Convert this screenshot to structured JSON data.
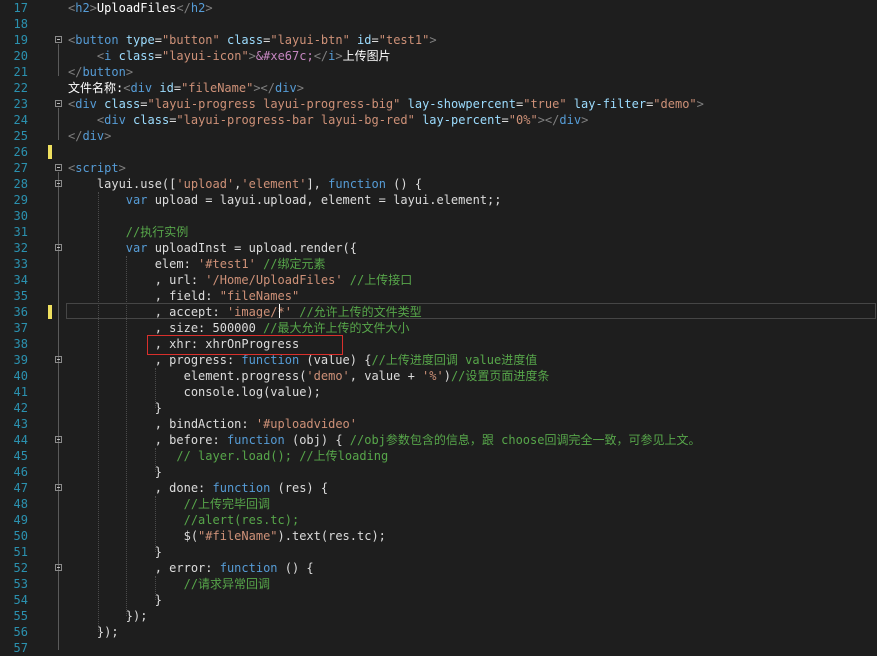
{
  "editor": {
    "lines": [
      {
        "num": "17",
        "tokens": [
          {
            "t": "<",
            "c": "tag"
          },
          {
            "t": "h2",
            "c": "tagname"
          },
          {
            "t": ">",
            "c": "tag"
          },
          {
            "t": "UploadFiles",
            "c": "text"
          },
          {
            "t": "</",
            "c": "tag"
          },
          {
            "t": "h2",
            "c": "tagname"
          },
          {
            "t": ">",
            "c": "tag"
          }
        ]
      },
      {
        "num": "18",
        "tokens": []
      },
      {
        "num": "19",
        "tokens": [
          {
            "t": "<",
            "c": "tag"
          },
          {
            "t": "button",
            "c": "tagname"
          },
          {
            "t": " type",
            "c": "attr"
          },
          {
            "t": "=",
            "c": "plain"
          },
          {
            "t": "\"button\"",
            "c": "str"
          },
          {
            "t": " class",
            "c": "attr"
          },
          {
            "t": "=",
            "c": "plain"
          },
          {
            "t": "\"layui-btn\"",
            "c": "str"
          },
          {
            "t": " id",
            "c": "attr"
          },
          {
            "t": "=",
            "c": "plain"
          },
          {
            "t": "\"test1\"",
            "c": "str"
          },
          {
            "t": ">",
            "c": "tag"
          }
        ]
      },
      {
        "num": "20",
        "tokens": [
          {
            "t": "    ",
            "c": "plain"
          },
          {
            "t": "<",
            "c": "tag"
          },
          {
            "t": "i",
            "c": "tagname"
          },
          {
            "t": " class",
            "c": "attr"
          },
          {
            "t": "=",
            "c": "plain"
          },
          {
            "t": "\"layui-icon\"",
            "c": "str"
          },
          {
            "t": ">",
            "c": "tag"
          },
          {
            "t": "&#xe67c;",
            "c": "entity"
          },
          {
            "t": "</",
            "c": "tag"
          },
          {
            "t": "i",
            "c": "tagname"
          },
          {
            "t": ">",
            "c": "tag"
          },
          {
            "t": "上传图片",
            "c": "text"
          }
        ]
      },
      {
        "num": "21",
        "tokens": [
          {
            "t": "</",
            "c": "tag"
          },
          {
            "t": "button",
            "c": "tagname"
          },
          {
            "t": ">",
            "c": "tag"
          }
        ]
      },
      {
        "num": "22",
        "tokens": [
          {
            "t": "文件名称:",
            "c": "text"
          },
          {
            "t": "<",
            "c": "tag"
          },
          {
            "t": "div",
            "c": "tagname"
          },
          {
            "t": " id",
            "c": "attr"
          },
          {
            "t": "=",
            "c": "plain"
          },
          {
            "t": "\"fileName\"",
            "c": "str"
          },
          {
            "t": "></",
            "c": "tag"
          },
          {
            "t": "div",
            "c": "tagname"
          },
          {
            "t": ">",
            "c": "tag"
          }
        ]
      },
      {
        "num": "23",
        "tokens": [
          {
            "t": "<",
            "c": "tag"
          },
          {
            "t": "div",
            "c": "tagname"
          },
          {
            "t": " class",
            "c": "attr"
          },
          {
            "t": "=",
            "c": "plain"
          },
          {
            "t": "\"layui-progress layui-progress-big\"",
            "c": "str"
          },
          {
            "t": " lay-showpercent",
            "c": "attr"
          },
          {
            "t": "=",
            "c": "plain"
          },
          {
            "t": "\"true\"",
            "c": "str"
          },
          {
            "t": " lay-filter",
            "c": "attr"
          },
          {
            "t": "=",
            "c": "plain"
          },
          {
            "t": "\"demo\"",
            "c": "str"
          },
          {
            "t": ">",
            "c": "tag"
          }
        ]
      },
      {
        "num": "24",
        "tokens": [
          {
            "t": "    ",
            "c": "plain"
          },
          {
            "t": "<",
            "c": "tag"
          },
          {
            "t": "div",
            "c": "tagname"
          },
          {
            "t": " class",
            "c": "attr"
          },
          {
            "t": "=",
            "c": "plain"
          },
          {
            "t": "\"layui-progress-bar layui-bg-red\"",
            "c": "str"
          },
          {
            "t": " lay-percent",
            "c": "attr"
          },
          {
            "t": "=",
            "c": "plain"
          },
          {
            "t": "\"0%\"",
            "c": "str"
          },
          {
            "t": "></",
            "c": "tag"
          },
          {
            "t": "div",
            "c": "tagname"
          },
          {
            "t": ">",
            "c": "tag"
          }
        ]
      },
      {
        "num": "25",
        "tokens": [
          {
            "t": "</",
            "c": "tag"
          },
          {
            "t": "div",
            "c": "tagname"
          },
          {
            "t": ">",
            "c": "tag"
          }
        ]
      },
      {
        "num": "26",
        "tokens": []
      },
      {
        "num": "27",
        "tokens": [
          {
            "t": "<",
            "c": "tag"
          },
          {
            "t": "script",
            "c": "tagname"
          },
          {
            "t": ">",
            "c": "tag"
          }
        ]
      },
      {
        "num": "28",
        "tokens": [
          {
            "t": "    layui.use([",
            "c": "plain"
          },
          {
            "t": "'upload'",
            "c": "str"
          },
          {
            "t": ",",
            "c": "plain"
          },
          {
            "t": "'element'",
            "c": "str"
          },
          {
            "t": "], ",
            "c": "plain"
          },
          {
            "t": "function",
            "c": "kw"
          },
          {
            "t": " () {",
            "c": "plain"
          }
        ]
      },
      {
        "num": "29",
        "tokens": [
          {
            "t": "        ",
            "c": "plain"
          },
          {
            "t": "var",
            "c": "kw"
          },
          {
            "t": " upload = layui.upload, element = layui.element;;",
            "c": "plain"
          }
        ]
      },
      {
        "num": "30",
        "tokens": []
      },
      {
        "num": "31",
        "tokens": [
          {
            "t": "        ",
            "c": "plain"
          },
          {
            "t": "//执行实例",
            "c": "comment"
          }
        ]
      },
      {
        "num": "32",
        "tokens": [
          {
            "t": "        ",
            "c": "plain"
          },
          {
            "t": "var",
            "c": "kw"
          },
          {
            "t": " uploadInst = upload.render({",
            "c": "plain"
          }
        ]
      },
      {
        "num": "33",
        "tokens": [
          {
            "t": "            elem: ",
            "c": "plain"
          },
          {
            "t": "'#test1'",
            "c": "str"
          },
          {
            "t": " ",
            "c": "plain"
          },
          {
            "t": "//绑定元素",
            "c": "comment"
          }
        ]
      },
      {
        "num": "34",
        "tokens": [
          {
            "t": "            , url: ",
            "c": "plain"
          },
          {
            "t": "'/Home/UploadFiles'",
            "c": "str"
          },
          {
            "t": " ",
            "c": "plain"
          },
          {
            "t": "//上传接口",
            "c": "comment"
          }
        ]
      },
      {
        "num": "35",
        "tokens": [
          {
            "t": "            , field: ",
            "c": "plain"
          },
          {
            "t": "\"fileNames\"",
            "c": "str"
          }
        ]
      },
      {
        "num": "36",
        "tokens": [
          {
            "t": "            , accept: ",
            "c": "plain"
          },
          {
            "t": "'image/*'",
            "c": "str"
          },
          {
            "t": " ",
            "c": "plain"
          },
          {
            "t": "//允许上传的文件类型",
            "c": "comment"
          }
        ]
      },
      {
        "num": "37",
        "tokens": [
          {
            "t": "            , size: 500000 ",
            "c": "plain"
          },
          {
            "t": "//最大允许上传的文件大小",
            "c": "comment"
          }
        ]
      },
      {
        "num": "38",
        "tokens": [
          {
            "t": "            , xhr: xhrOnProgress",
            "c": "plain"
          }
        ]
      },
      {
        "num": "39",
        "tokens": [
          {
            "t": "            , progress: ",
            "c": "plain"
          },
          {
            "t": "function",
            "c": "kw"
          },
          {
            "t": " (value) {",
            "c": "plain"
          },
          {
            "t": "//上传进度回调 value进度值",
            "c": "comment"
          }
        ]
      },
      {
        "num": "40",
        "tokens": [
          {
            "t": "                element.progress(",
            "c": "plain"
          },
          {
            "t": "'demo'",
            "c": "str"
          },
          {
            "t": ", value + ",
            "c": "plain"
          },
          {
            "t": "'%'",
            "c": "str"
          },
          {
            "t": ")",
            "c": "plain"
          },
          {
            "t": "//设置页面进度条",
            "c": "comment"
          }
        ]
      },
      {
        "num": "41",
        "tokens": [
          {
            "t": "                console.log(value);",
            "c": "plain"
          }
        ]
      },
      {
        "num": "42",
        "tokens": [
          {
            "t": "            }",
            "c": "plain"
          }
        ]
      },
      {
        "num": "43",
        "tokens": [
          {
            "t": "            , bindAction: ",
            "c": "plain"
          },
          {
            "t": "'#uploadvideo'",
            "c": "str"
          }
        ]
      },
      {
        "num": "44",
        "tokens": [
          {
            "t": "            , before: ",
            "c": "plain"
          },
          {
            "t": "function",
            "c": "kw"
          },
          {
            "t": " (obj) { ",
            "c": "plain"
          },
          {
            "t": "//obj参数包含的信息，跟 choose回调完全一致，可参见上文。",
            "c": "comment"
          }
        ]
      },
      {
        "num": "45",
        "tokens": [
          {
            "t": "               ",
            "c": "plain"
          },
          {
            "t": "// layer.load(); //上传loading",
            "c": "comment"
          }
        ]
      },
      {
        "num": "46",
        "tokens": [
          {
            "t": "            }",
            "c": "plain"
          }
        ]
      },
      {
        "num": "47",
        "tokens": [
          {
            "t": "            , done: ",
            "c": "plain"
          },
          {
            "t": "function",
            "c": "kw"
          },
          {
            "t": " (res) {",
            "c": "plain"
          }
        ]
      },
      {
        "num": "48",
        "tokens": [
          {
            "t": "                ",
            "c": "plain"
          },
          {
            "t": "//上传完毕回调",
            "c": "comment"
          }
        ]
      },
      {
        "num": "49",
        "tokens": [
          {
            "t": "                ",
            "c": "plain"
          },
          {
            "t": "//alert(res.tc);",
            "c": "comment"
          }
        ]
      },
      {
        "num": "50",
        "tokens": [
          {
            "t": "                $(",
            "c": "plain"
          },
          {
            "t": "\"#fileName\"",
            "c": "str"
          },
          {
            "t": ").text(res.tc);",
            "c": "plain"
          }
        ]
      },
      {
        "num": "51",
        "tokens": [
          {
            "t": "            }",
            "c": "plain"
          }
        ]
      },
      {
        "num": "52",
        "tokens": [
          {
            "t": "            , error: ",
            "c": "plain"
          },
          {
            "t": "function",
            "c": "kw"
          },
          {
            "t": " () {",
            "c": "plain"
          }
        ]
      },
      {
        "num": "53",
        "tokens": [
          {
            "t": "                ",
            "c": "plain"
          },
          {
            "t": "//请求异常回调",
            "c": "comment"
          }
        ]
      },
      {
        "num": "54",
        "tokens": [
          {
            "t": "            }",
            "c": "plain"
          }
        ]
      },
      {
        "num": "55",
        "tokens": [
          {
            "t": "        });",
            "c": "plain"
          }
        ]
      },
      {
        "num": "56",
        "tokens": [
          {
            "t": "    });",
            "c": "plain"
          }
        ]
      },
      {
        "num": "57",
        "tokens": []
      }
    ],
    "colors": {
      "background": "#1e1e1e",
      "line_number": "#2b91af",
      "tag": "#808080",
      "tag_name": "#569cd6",
      "attribute": "#9cdcfe",
      "string": "#ce9178",
      "keyword": "#569cd6",
      "comment": "#57a64a",
      "plain": "#dcdcdc",
      "highlight_box": "#d9302c",
      "change_marker": "#efe05f"
    }
  }
}
